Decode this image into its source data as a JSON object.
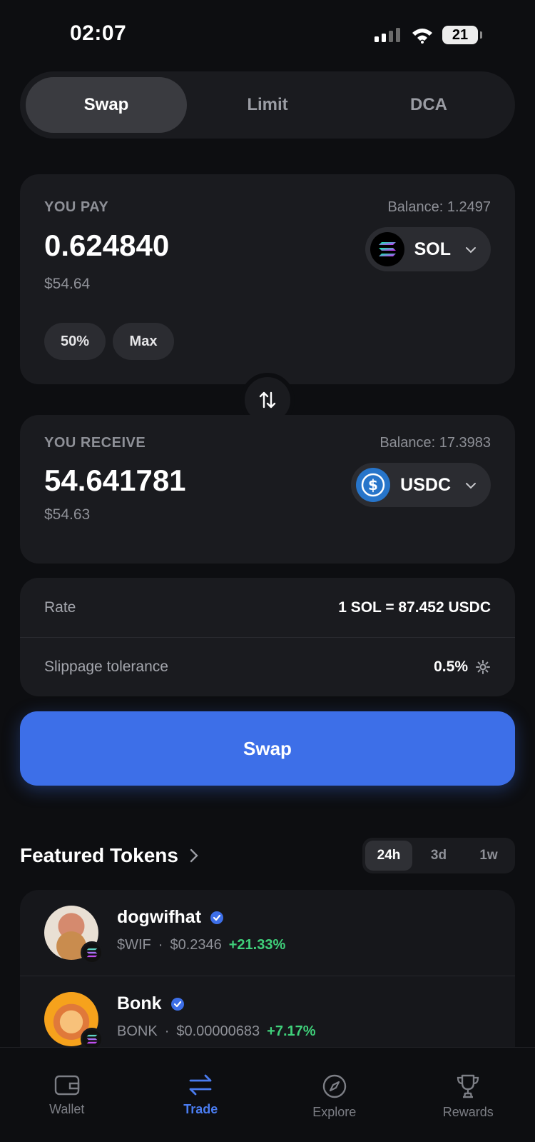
{
  "status_bar": {
    "time": "02:07",
    "battery": "21"
  },
  "mode_tabs": [
    {
      "label": "Swap",
      "active": true
    },
    {
      "label": "Limit",
      "active": false
    },
    {
      "label": "DCA",
      "active": false
    }
  ],
  "pay": {
    "label": "YOU PAY",
    "balance": "Balance: 1.2497",
    "amount": "0.624840",
    "usd": "$54.64",
    "token": "SOL",
    "quick_buttons": [
      "50%",
      "Max"
    ]
  },
  "receive": {
    "label": "YOU RECEIVE",
    "balance": "Balance: 17.3983",
    "amount": "54.641781",
    "usd": "$54.63",
    "token": "USDC"
  },
  "rate": {
    "rate_label": "Rate",
    "rate_value": "1 SOL = 87.452 USDC",
    "slippage_label": "Slippage tolerance",
    "slippage_value": "0.5%"
  },
  "swap_button": "Swap",
  "featured": {
    "title": "Featured Tokens",
    "ranges": [
      {
        "label": "24h",
        "active": true
      },
      {
        "label": "3d",
        "active": false
      },
      {
        "label": "1w",
        "active": false
      }
    ],
    "tokens": [
      {
        "name": "dogwifhat",
        "symbol": "$WIF",
        "price": "$0.2346",
        "change": "+21.33%",
        "verified": true
      },
      {
        "name": "Bonk",
        "symbol": "BONK",
        "price": "$0.00000683",
        "change": "+7.17%",
        "verified": true
      }
    ]
  },
  "bottom_nav": [
    {
      "label": "Wallet",
      "icon": "wallet-icon",
      "active": false
    },
    {
      "label": "Trade",
      "icon": "swap-arrows-icon",
      "active": true
    },
    {
      "label": "Explore",
      "icon": "compass-icon",
      "active": false
    },
    {
      "label": "Rewards",
      "icon": "trophy-icon",
      "active": false
    }
  ],
  "colors": {
    "accent": "#3d6fe8",
    "positive": "#3fd07a",
    "background": "#0d0e11",
    "card": "#1a1b1f"
  }
}
